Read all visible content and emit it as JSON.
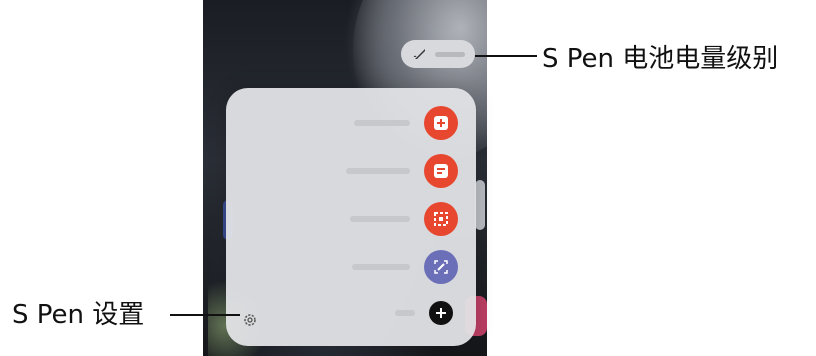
{
  "callouts": {
    "battery_label": "S Pen 电池电量级别",
    "settings_label": "S Pen 设置"
  },
  "air_command": {
    "items": [
      {
        "icon": "create-note-icon",
        "color": "#e8472f"
      },
      {
        "icon": "view-all-notes-icon",
        "color": "#e8472f"
      },
      {
        "icon": "smart-select-icon",
        "color": "#e8472f"
      },
      {
        "icon": "screen-write-icon",
        "color": "#6a6fb8"
      },
      {
        "icon": "add-icon",
        "color": "#111111"
      }
    ],
    "settings_icon": "gear-icon",
    "battery_icon": "s-pen-icon"
  }
}
